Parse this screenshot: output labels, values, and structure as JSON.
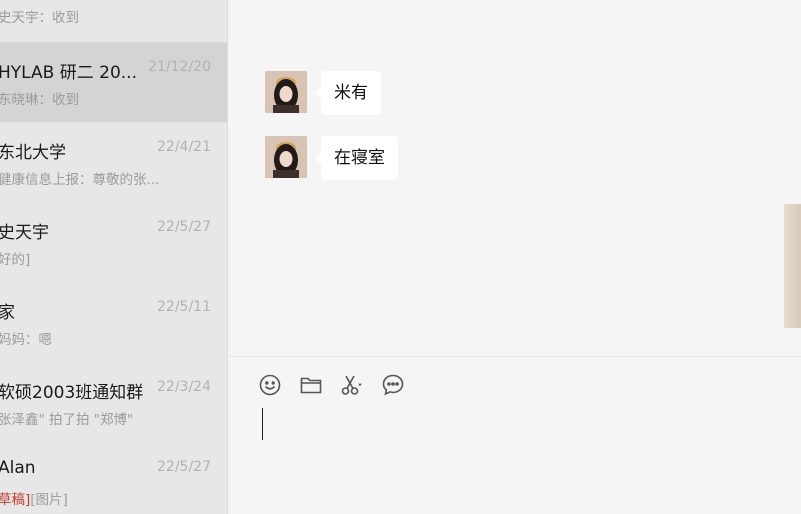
{
  "sidebar": {
    "conversations": [
      {
        "name": "",
        "time": "",
        "preview": "史天宇：收到",
        "selected": false
      },
      {
        "name": "HYLAB 研二 20...",
        "time": "21/12/20",
        "preview": "东晓琳：收到",
        "selected": true
      },
      {
        "name": "东北大学",
        "time": "22/4/21",
        "preview": "健康信息上报：尊敬的张...",
        "selected": false
      },
      {
        "name": "史天宇",
        "time": "22/5/27",
        "preview": "好的]",
        "selected": false
      },
      {
        "name": "家",
        "time": "22/5/11",
        "preview": "妈妈：嗯",
        "selected": false
      },
      {
        "name": "软硕2003班通知群",
        "time": "22/3/24",
        "preview": "张泽鑫\" 拍了拍 \"郑博\"",
        "selected": false
      },
      {
        "name": "Alan",
        "time": "22/5/27",
        "preview_draft": "草稿]",
        "preview": "[图片]",
        "selected": false
      }
    ]
  },
  "chat": {
    "messages": [
      {
        "text": "米有"
      },
      {
        "text": "在寝室"
      }
    ]
  },
  "input_toolbar": {
    "tools": [
      "emoji-icon",
      "folder-icon",
      "scissors-icon",
      "chat-bubble-icon"
    ]
  },
  "colors": {
    "sidebar_bg": "#e7e7e7",
    "selected_bg": "#d4d4d4",
    "chat_bg": "#f5f5f5",
    "draft_red": "#c03a2b"
  }
}
